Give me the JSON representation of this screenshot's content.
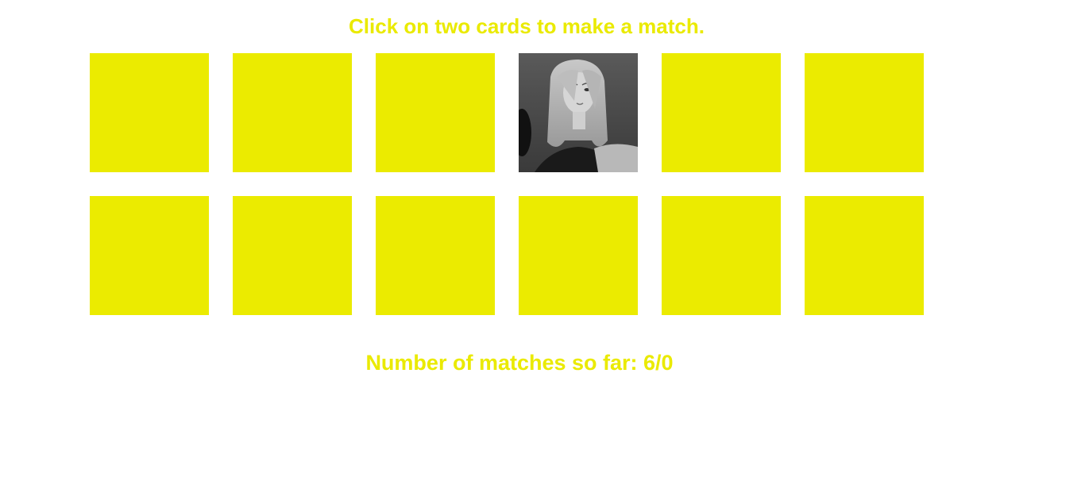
{
  "header": {
    "instructions": "Click on two cards to make a match."
  },
  "board": {
    "card_back_color": "#ebeb00",
    "cards": [
      {
        "state": "face-down"
      },
      {
        "state": "face-down"
      },
      {
        "state": "face-down"
      },
      {
        "state": "face-up",
        "image": "portrait-photo"
      },
      {
        "state": "face-down"
      },
      {
        "state": "face-down"
      },
      {
        "state": "face-down"
      },
      {
        "state": "face-down"
      },
      {
        "state": "face-down"
      },
      {
        "state": "face-down"
      },
      {
        "state": "face-down"
      },
      {
        "state": "face-down"
      }
    ]
  },
  "footer": {
    "score_text": "Number of matches so far: 6/0"
  },
  "colors": {
    "text": "#eaea00",
    "card_back": "#ebeb00",
    "background": "#ffffff"
  }
}
